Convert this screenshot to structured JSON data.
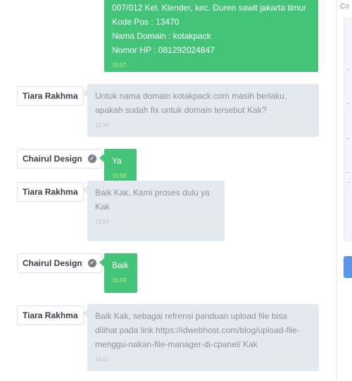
{
  "messages": [
    {
      "lines": [
        "007/012 Kel. Klender, kec. Duren sawit jakarta timur",
        "Kode Pos : 13470",
        "Nama Domain : kotakpack",
        "Nomor HP : 081292024847"
      ],
      "time": "15:57"
    },
    {
      "sender": "Tiara Rakhma",
      "text": "Untuk nama domain kotakpack.com masih berlaku, apakah sudah fix untuk domain tersebut Kak?",
      "time": "15:58"
    },
    {
      "sender": "Chairul Design",
      "text": "Ya",
      "time": "15:58"
    },
    {
      "sender": "Tiara Rakhma",
      "text": "Baik Kak, Kami proses dulu ya Kak",
      "time": "15:59"
    },
    {
      "sender": "Chairul Design",
      "text": "Baik",
      "time": "15:59"
    },
    {
      "sender": "Tiara Rakhma",
      "text": "Baik Kak, sebagai refrensi panduan upload file bisa dilihat pada link https://idwebhost.com/blog/upload-file-menggu-nakan-file-manager-di-cpanel/ Kak",
      "time": "16:01"
    }
  ],
  "side_panel": {
    "label": "Co"
  },
  "colors": {
    "own_bubble": "#43c479",
    "own_time": "#c6f07f",
    "other_bubble": "#e4e9f0",
    "side_button": "#5b95e8"
  },
  "icons": {
    "verified": "check-circle-icon"
  }
}
